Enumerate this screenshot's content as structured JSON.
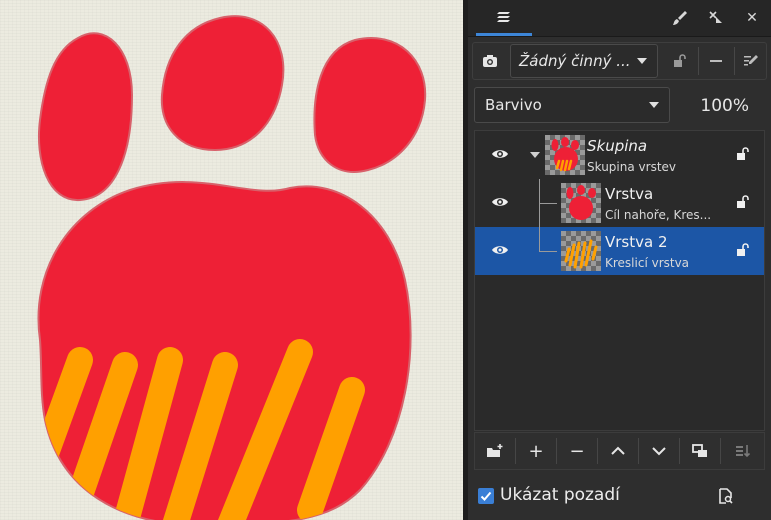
{
  "panel": {
    "tabs": {
      "layers_icon": "layers-icon"
    },
    "header_buttons": [
      "brush-icon",
      "dock-icon",
      "close-icon"
    ],
    "close_symbol": "✕",
    "snapshot_dropdown": {
      "value": "Žádný činný ..."
    },
    "blend_mode": {
      "value": "Barvivo"
    },
    "opacity": "100%",
    "layers": [
      {
        "name": "Skupina",
        "subtitle": "Skupina vrstev",
        "visible": true,
        "locked": false,
        "expanded": true,
        "selected": false
      },
      {
        "name": "Vrstva",
        "subtitle": "Cíl nahoře, Kres...",
        "visible": true,
        "locked": false,
        "selected": false
      },
      {
        "name": "Vrstva 2",
        "subtitle": "Kreslicí vrstva",
        "visible": true,
        "locked": false,
        "selected": true
      }
    ],
    "bottom_buttons": [
      "add-group-icon",
      "add-layer-icon",
      "remove-layer-icon",
      "move-up-icon",
      "move-down-icon",
      "duplicate-icon",
      "merge-down-icon"
    ],
    "add_symbol": "+",
    "remove_symbol": "−",
    "show_background": {
      "label": "Ukázat pozadí",
      "checked": true
    }
  },
  "colors": {
    "accent": "#3d86d8",
    "selection": "#1c56a6",
    "paw_red": "#ee2036",
    "stripe_orange": "#ffa000",
    "paper": "#ecebe0"
  }
}
